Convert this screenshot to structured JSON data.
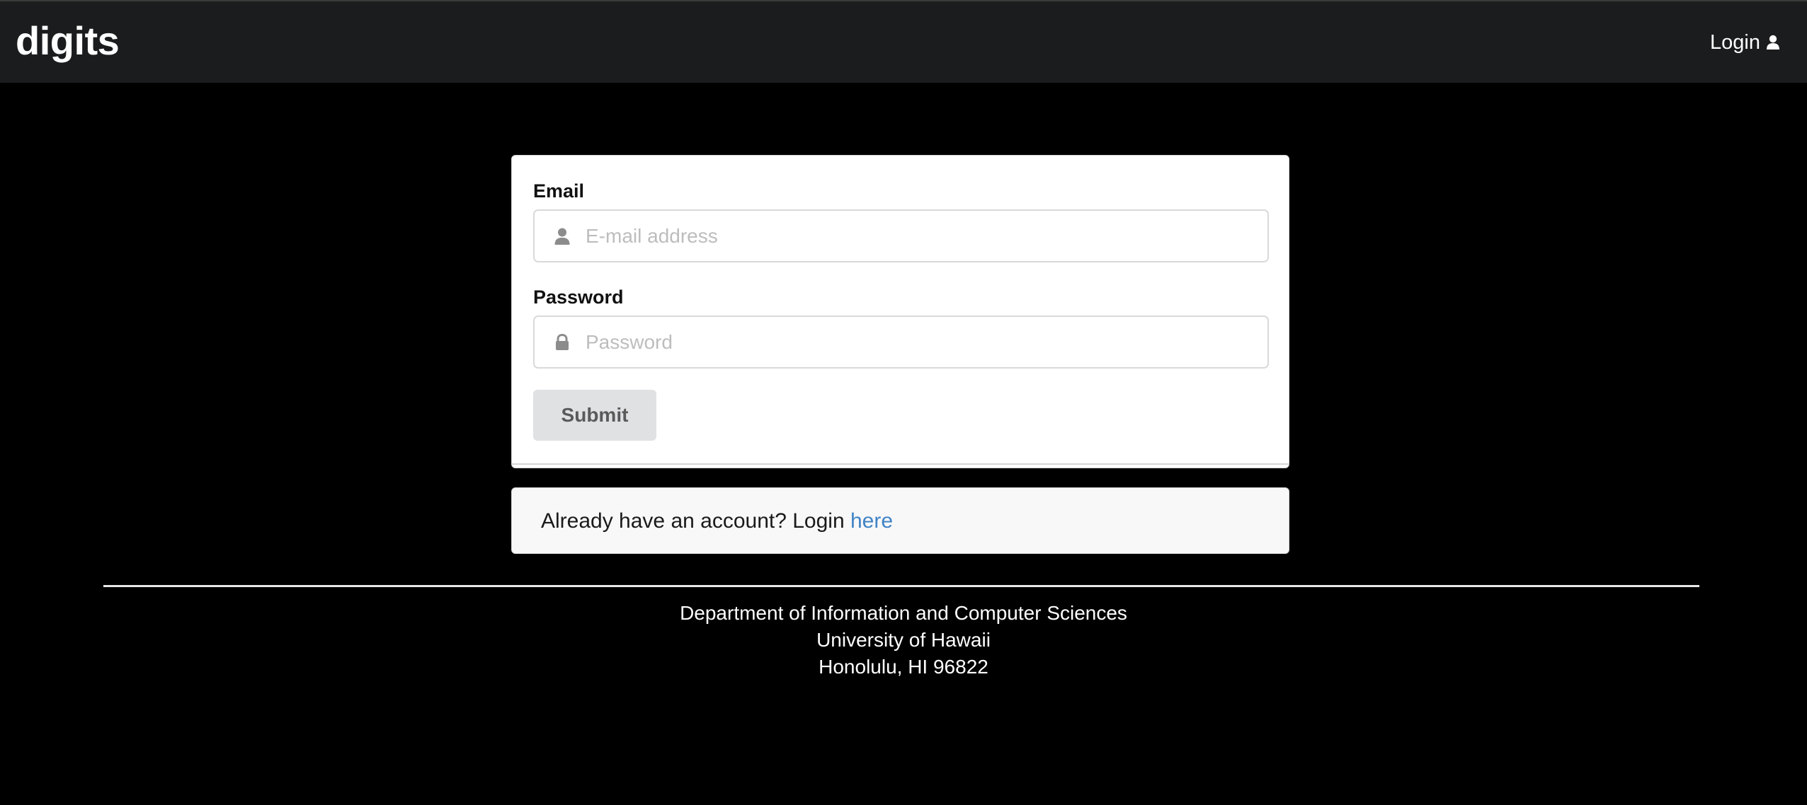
{
  "navbar": {
    "brand": "digits",
    "login_label": "Login",
    "login_icon": "user-icon"
  },
  "form": {
    "email": {
      "label": "Email",
      "placeholder": "E-mail address",
      "value": "",
      "icon": "user-icon"
    },
    "password": {
      "label": "Password",
      "placeholder": "Password",
      "value": "",
      "icon": "lock-icon"
    },
    "submit_label": "Submit"
  },
  "message": {
    "text": "Already have an account? Login ",
    "link_label": "here"
  },
  "footer": {
    "line1": "Department of Information and Computer Sciences",
    "line2": "University of Hawaii",
    "line3": "Honolulu, HI 96822"
  },
  "colors": {
    "background": "#000000",
    "navbar": "#1b1c1d",
    "link": "#4183c4",
    "button": "#e0e1e2"
  }
}
